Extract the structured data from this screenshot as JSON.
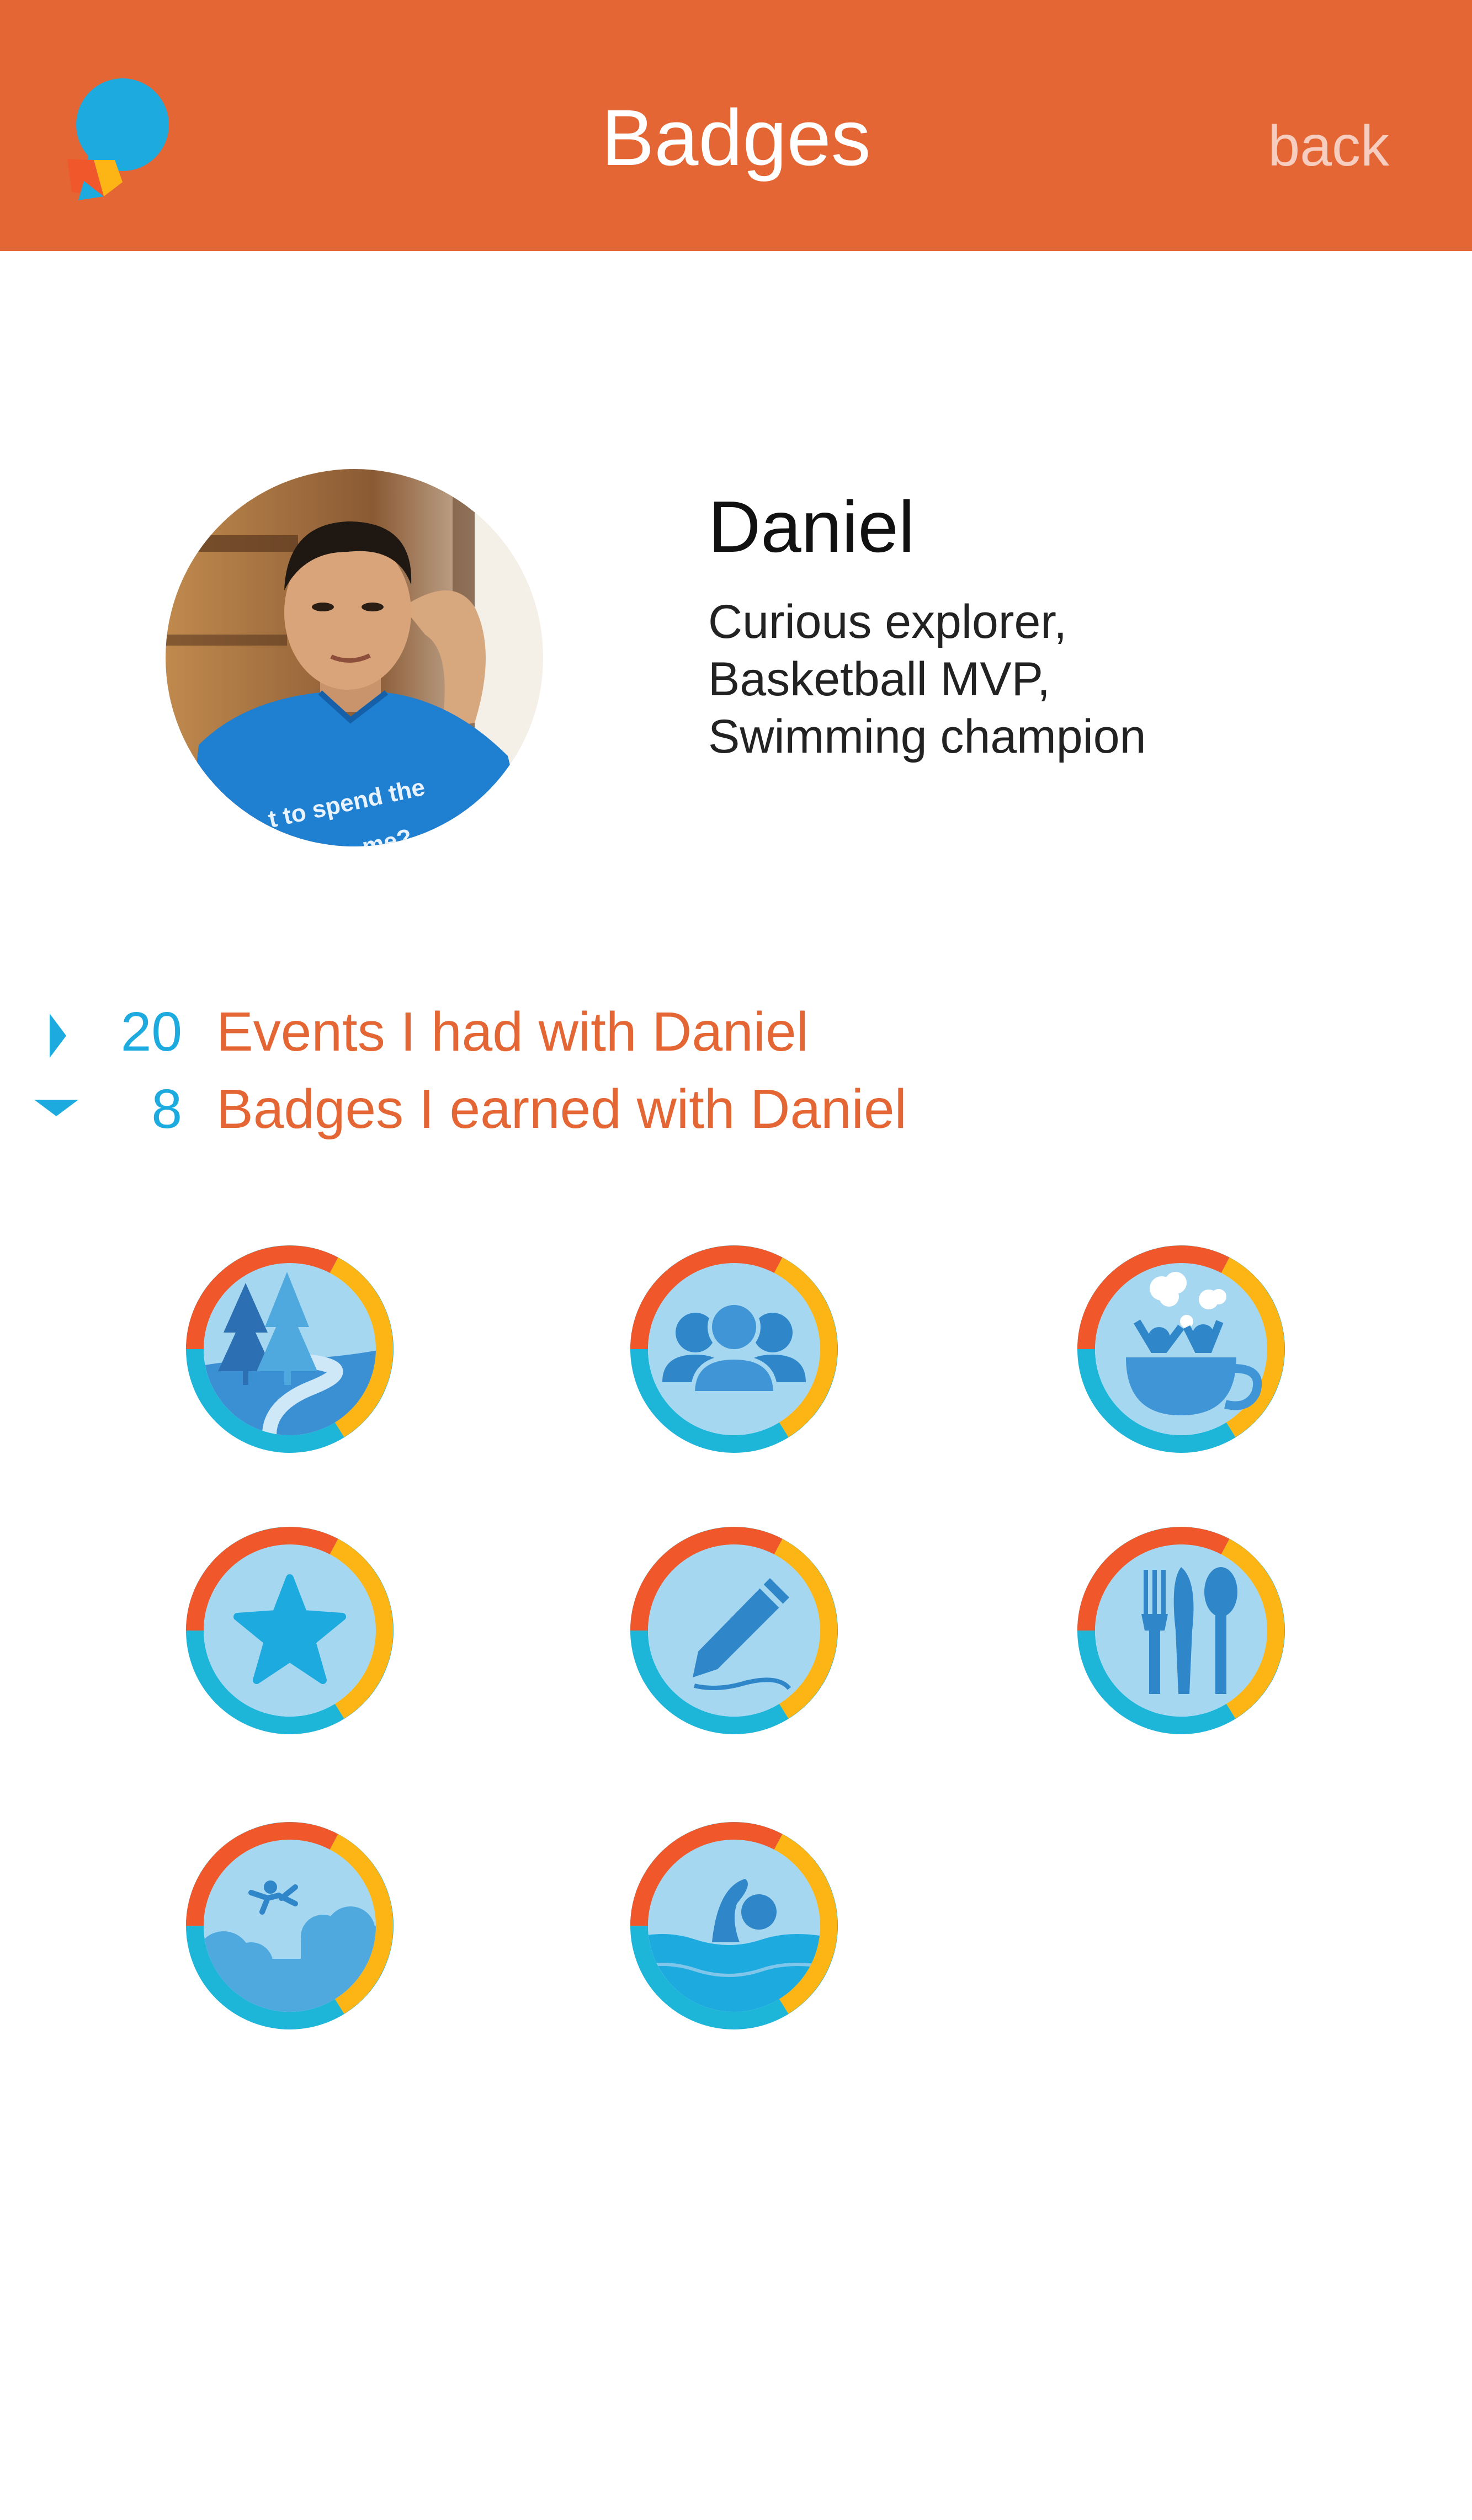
{
  "header": {
    "title": "Badges",
    "back_label": "back",
    "logo_icon": "chat-bubble-logo-icon",
    "background_color": "#E46634"
  },
  "profile": {
    "name": "Daniel",
    "bio": [
      "Curious explorer,",
      "Basketball MVP,",
      "Swimming champion"
    ],
    "avatar_icon": "profile-photo",
    "shirt_text": [
      "t to spend the",
      "me?"
    ]
  },
  "stats": [
    {
      "count": "20",
      "label": "Events I had with Daniel",
      "expanded": false
    },
    {
      "count": "8",
      "label": "Badges I earned with Daniel",
      "expanded": true
    }
  ],
  "badges": [
    {
      "icon": "forest-river-icon"
    },
    {
      "icon": "group-people-icon"
    },
    {
      "icon": "teacup-celebration-icon"
    },
    {
      "icon": "star-icon"
    },
    {
      "icon": "pencil-icon"
    },
    {
      "icon": "cutlery-icon"
    },
    {
      "icon": "skydiving-clouds-icon"
    },
    {
      "icon": "swimmer-icon"
    }
  ],
  "colors": {
    "accent_orange": "#E46634",
    "accent_blue": "#1DAADF",
    "ring_red": "#F0572A",
    "ring_yellow": "#FDB515",
    "ring_teal": "#1DB6D9",
    "badge_fill": "#A6D7F0",
    "icon_blue": "#2F86C8"
  }
}
